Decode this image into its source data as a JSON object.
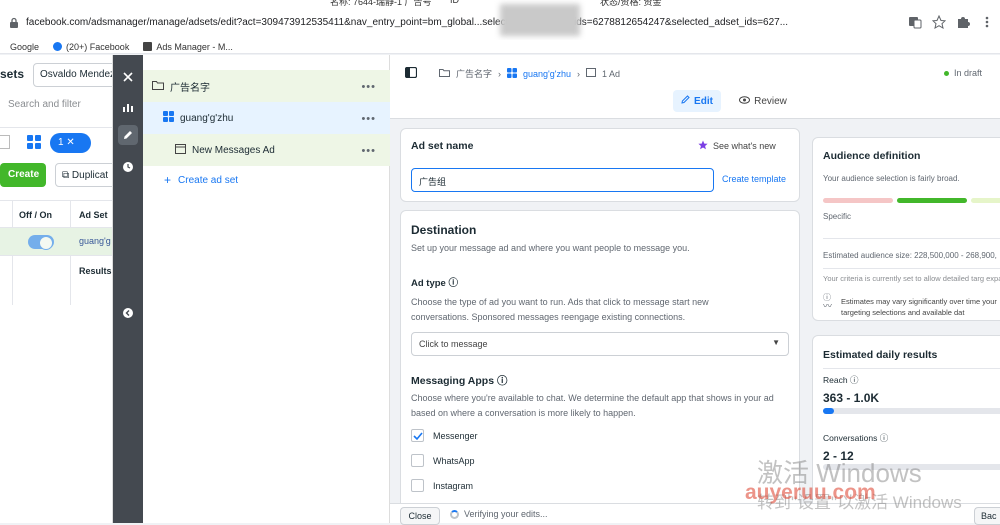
{
  "browser": {
    "tab_fragments": [
      "名称: 7644-瑞静-1 广告号",
      "ID",
      "状态/资格: 资金"
    ],
    "url": "facebook.com/adsmanager/manage/adsets/edit?act=309473912535411&nav_entry_point=bm_global...selected_campaign_ids=6278812654247&selected_adset_ids=627..."
  },
  "bookmarks": [
    {
      "label": "Google",
      "icon": "google-icon"
    },
    {
      "label": "(20+) Facebook",
      "icon": "facebook-icon"
    },
    {
      "label": "Ads Manager - M...",
      "icon": "ads-manager-icon"
    }
  ],
  "left_panel": {
    "title": "sets",
    "account": "Osvaldo Mendez",
    "search_placeholder": "Search and filter",
    "selected_pill": "1 ✕",
    "create_label": "Create",
    "duplicate_label": "Duplicat",
    "col_off_on": "Off / On",
    "col_adset": "Ad Set",
    "row_link": "guang'g",
    "results_label": "Results"
  },
  "tree": {
    "campaign": "广告名字",
    "adset": "guang'g'zhu",
    "ad": "New Messages Ad",
    "create_adset": "Create ad set",
    "more": "•••"
  },
  "editor": {
    "crumbs": {
      "campaign": "广告名字",
      "adset": "guang'g'zhu",
      "ad": "1 Ad"
    },
    "status": "In draft",
    "edit_label": "Edit",
    "review_label": "Review",
    "adset_name_heading": "Ad set name",
    "whats_new": "See what's new",
    "adset_name_value": "广告组",
    "create_template": "Create template",
    "destination_heading": "Destination",
    "destination_desc": "Set up your message ad and where you want people to message you.",
    "ad_type_heading": "Ad type",
    "ad_type_desc": "Choose the type of ad you want to run. Ads that click to message start new conversations. Sponsored messages reengage existing connections.",
    "ad_type_value": "Click to message",
    "messaging_apps_heading": "Messaging Apps",
    "messaging_apps_desc": "Choose where you're available to chat. We determine the default app that shows in your ad based on where a conversation is more likely to happen.",
    "apps": [
      {
        "label": "Messenger",
        "checked": true
      },
      {
        "label": "WhatsApp",
        "checked": false
      },
      {
        "label": "Instagram",
        "checked": false
      }
    ],
    "close_label": "Close",
    "verifying": "Verifying your edits...",
    "back_label": "Bac"
  },
  "audience": {
    "heading": "Audience definition",
    "broad_text": "Your audience selection is fairly broad.",
    "specific": "Specific",
    "estimated_size": "Estimated audience size: 228,500,000 - 268,900,",
    "criteria": "Your criteria is currently set to allow detailed targ expansion.",
    "estimates": "Estimates may vary significantly over time your targeting selections and available dat"
  },
  "daily": {
    "heading": "Estimated daily results",
    "reach_label": "Reach",
    "reach_value": "363 - 1.0K",
    "conv_label": "Conversations",
    "conv_value": "2 - 12"
  },
  "watermarks": {
    "activate": "激活 Windows",
    "site": "auyeruu.com",
    "activate2": "转到\"设置\"以激活 Windows"
  },
  "colors": {
    "accent": "#1877f2",
    "create_green": "#42b72a",
    "rail": "#444950"
  }
}
